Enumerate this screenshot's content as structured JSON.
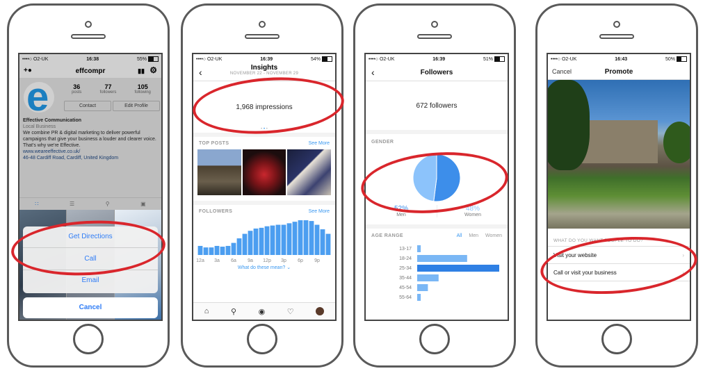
{
  "phone1": {
    "status": {
      "carrier": "••••○ O2-UK",
      "time": "16:38",
      "battery": "55%",
      "battery_level": 0.55
    },
    "username": "effcompr",
    "stats": [
      {
        "value": "36",
        "label": "posts"
      },
      {
        "value": "77",
        "label": "followers"
      },
      {
        "value": "105",
        "label": "following"
      }
    ],
    "contact_label": "Contact",
    "edit_profile_label": "Edit Profile",
    "avatar_letter": "e",
    "bio": {
      "name": "Effective Communication",
      "category": "Local Business",
      "text": "We combine PR & digital marketing to deliver powerful campaigns that give your business a louder and clearer voice. That's why we're Effective.",
      "website": "www.weareeffective.co.uk/",
      "address": "46-48 Cardiff Road, Cardiff, United Kingdom"
    },
    "sheet": {
      "directions": "Get Directions",
      "call": "Call",
      "email": "Email",
      "cancel": "Cancel"
    }
  },
  "phone2": {
    "status": {
      "carrier": "••••○ O2-UK",
      "time": "16:39",
      "battery": "54%",
      "battery_level": 0.54
    },
    "title": "Insights",
    "subtitle": "NOVEMBER 22 - NOVEMBER 29",
    "impressions": "1,968 impressions",
    "top_posts_label": "TOP POSTS",
    "followers_label": "FOLLOWERS",
    "see_more": "See More",
    "chart_data": {
      "type": "bar",
      "categories": [
        "12a",
        "1a",
        "2a",
        "3a",
        "4a",
        "5a",
        "6a",
        "7a",
        "8a",
        "9a",
        "10a",
        "11a",
        "12p",
        "1p",
        "2p",
        "3p",
        "4p",
        "5p",
        "6p",
        "7p",
        "8p",
        "9p",
        "10p",
        "11p"
      ],
      "values": [
        12,
        10,
        10,
        12,
        11,
        12,
        16,
        22,
        28,
        32,
        35,
        36,
        38,
        39,
        40,
        40,
        42,
        44,
        46,
        46,
        45,
        40,
        34,
        28
      ],
      "tick_labels": [
        "12a",
        "3a",
        "6a",
        "9a",
        "12p",
        "3p",
        "6p",
        "9p"
      ],
      "color": "#4c9ef0"
    },
    "explain_link": "What do these mean? ⌄"
  },
  "phone3": {
    "status": {
      "carrier": "••••○ O2-UK",
      "time": "16:39",
      "battery": "51%",
      "battery_level": 0.51
    },
    "title": "Followers",
    "count": "672 followers",
    "gender_label": "GENDER",
    "gender_chart": {
      "type": "pie",
      "slices": [
        {
          "name": "Men",
          "pct": "52%",
          "value": 52,
          "color": "#3d8eea"
        },
        {
          "name": "Women",
          "pct": "48%",
          "value": 48,
          "color": "#8cc3fb"
        }
      ]
    },
    "age_label": "AGE RANGE",
    "age_filters": [
      "All",
      "Men",
      "Women"
    ],
    "age_chart": {
      "type": "bar",
      "categories": [
        "13-17",
        "18-24",
        "25-34",
        "35-44",
        "45-54",
        "55-64"
      ],
      "values": [
        2,
        28,
        46,
        12,
        6,
        2
      ],
      "color": "#7ab7f5",
      "highlight_color": "#2f80e4"
    }
  },
  "phone4": {
    "status": {
      "carrier": "••••○ O2-UK",
      "time": "16:43",
      "battery": "50%",
      "battery_level": 0.5
    },
    "cancel": "Cancel",
    "title": "Promote",
    "question": "WHAT DO YOU WANT PEOPLE TO DO?",
    "options": [
      "Visit your website",
      "Call or visit your business"
    ]
  }
}
